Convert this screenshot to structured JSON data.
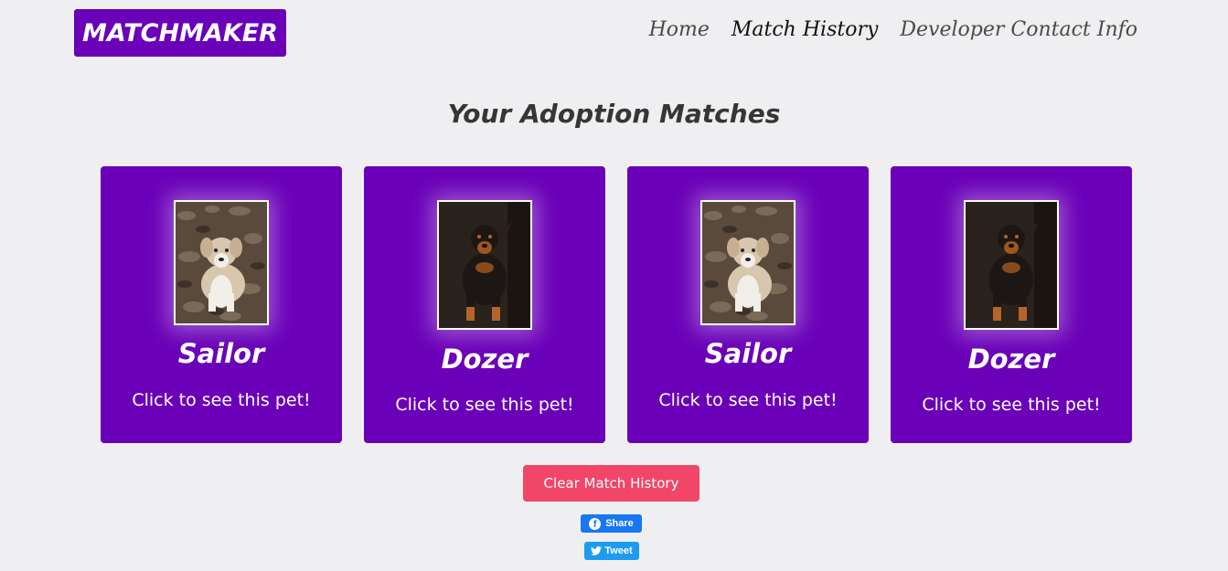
{
  "header": {
    "brand": "MATCHMAKER",
    "nav": [
      {
        "label": "Home"
      },
      {
        "label": "Match History"
      },
      {
        "label": "Developer Contact Info"
      }
    ],
    "active_nav": "Match History"
  },
  "main": {
    "title": "Your Adoption Matches",
    "matches": [
      {
        "name": "Sailor",
        "cta": "Click to see this pet!",
        "photo_icon": "dog-photo"
      },
      {
        "name": "Dozer",
        "cta": "Click to see this pet!",
        "photo_icon": "dog-photo"
      },
      {
        "name": "Sailor",
        "cta": "Click to see this pet!",
        "photo_icon": "dog-photo"
      },
      {
        "name": "Dozer",
        "cta": "Click to see this pet!",
        "photo_icon": "dog-photo"
      }
    ],
    "clear_button": "Clear Match History"
  },
  "social": {
    "share_label": "Share",
    "tweet_label": "Tweet"
  },
  "colors": {
    "brand_purple": "#6a00b8",
    "danger": "#f14668",
    "facebook": "#1877f2",
    "twitter": "#1d9bf0",
    "background": "#efeff1"
  }
}
